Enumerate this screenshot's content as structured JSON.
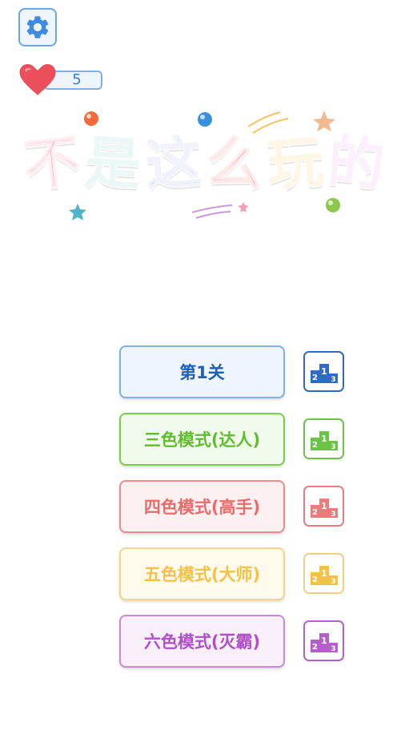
{
  "header": {
    "settings_icon": "gear-icon",
    "lives": {
      "icon": "heart-icon",
      "count": "5"
    }
  },
  "logo": {
    "text": "不是这么玩的",
    "chars": [
      "不",
      "是",
      "这",
      "么",
      "玩",
      "的"
    ]
  },
  "modes": [
    {
      "label": "第1关",
      "color": "#2d6bc4",
      "rank_icon": "podium-icon"
    },
    {
      "label": "三色模式(达人)",
      "color": "#6cc447",
      "rank_icon": "podium-icon"
    },
    {
      "label": "四色模式(高手)",
      "color": "#e97c7c",
      "rank_icon": "podium-icon"
    },
    {
      "label": "五色模式(大师)",
      "color": "#f5c144",
      "rank_icon": "podium-icon"
    },
    {
      "label": "六色模式(灭霸)",
      "color": "#b560c9",
      "rank_icon": "podium-icon"
    }
  ]
}
